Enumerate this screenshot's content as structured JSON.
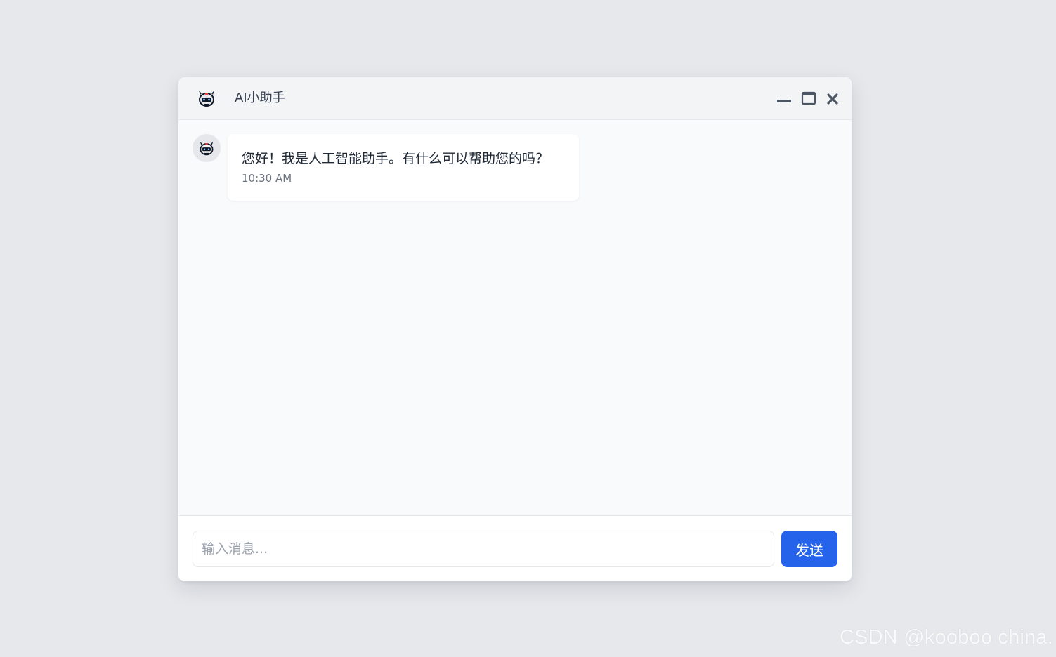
{
  "window": {
    "title": "AI小助手",
    "logo_icon": "robot-icon",
    "controls": {
      "minimize_icon": "minimize-icon",
      "maximize_icon": "maximize-icon",
      "close_icon": "close-icon"
    }
  },
  "messages": [
    {
      "sender": "assistant",
      "avatar_icon": "robot-icon",
      "text": "您好！我是人工智能助手。有什么可以帮助您的吗？",
      "time": "10:30 AM"
    }
  ],
  "input": {
    "value": "",
    "placeholder": "输入消息..."
  },
  "send_button": {
    "label": "发送"
  },
  "watermark": "CSDN @kooboo china.",
  "colors": {
    "accent": "#2563eb",
    "background": "#e6e8ec",
    "window_bg": "#f8fafc",
    "titlebar_bg": "#f3f4f6",
    "bubble_bg": "#ffffff"
  }
}
